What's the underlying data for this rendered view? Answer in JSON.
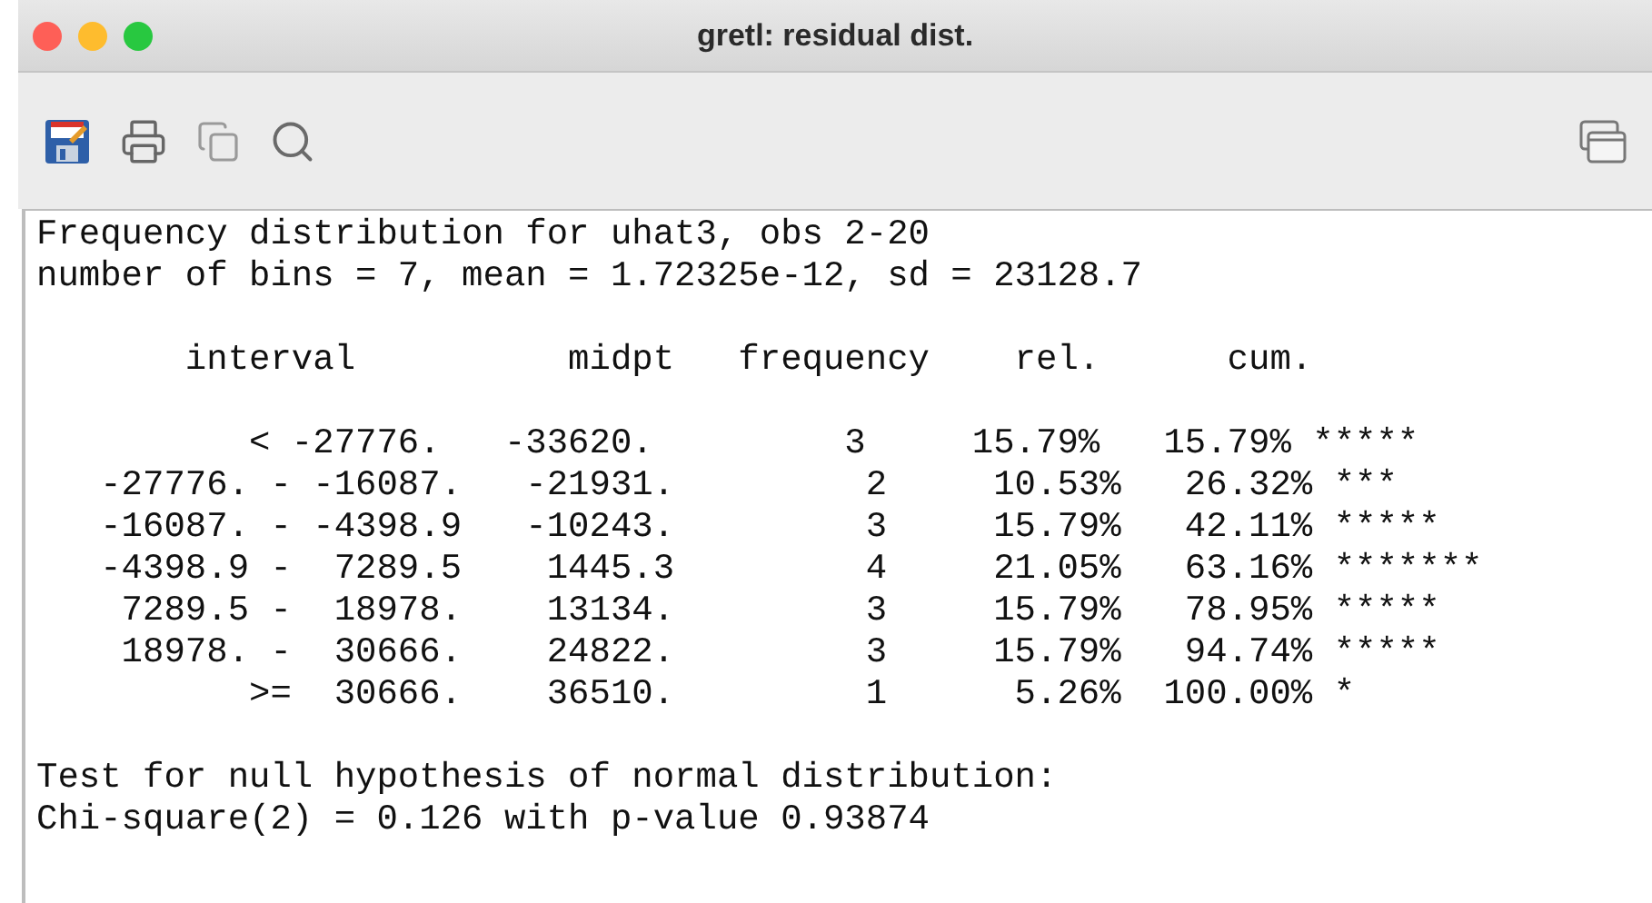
{
  "window": {
    "title": "gretl: residual dist."
  },
  "output": {
    "header": [
      "Frequency distribution for uhat3, obs 2-20",
      "number of bins = 7, mean = 1.72325e-12, sd = 23128.7"
    ],
    "column_line": "       interval          midpt   frequency    rel.      cum.",
    "rows": [
      "          < -27776.   -33620.         3     15.79%   15.79% *****",
      "   -27776. - -16087.   -21931.         2     10.53%   26.32% ***",
      "   -16087. - -4398.9   -10243.         3     15.79%   42.11% *****",
      "   -4398.9 -  7289.5    1445.3         4     21.05%   63.16% *******",
      "    7289.5 -  18978.    13134.         3     15.79%   78.95% *****",
      "    18978. -  30666.    24822.         3     15.79%   94.74% *****",
      "          >=  30666.    36510.         1      5.26%  100.00% *"
    ],
    "test": [
      "Test for null hypothesis of normal distribution:",
      "Chi-square(2) = 0.126 with p-value 0.93874"
    ]
  }
}
